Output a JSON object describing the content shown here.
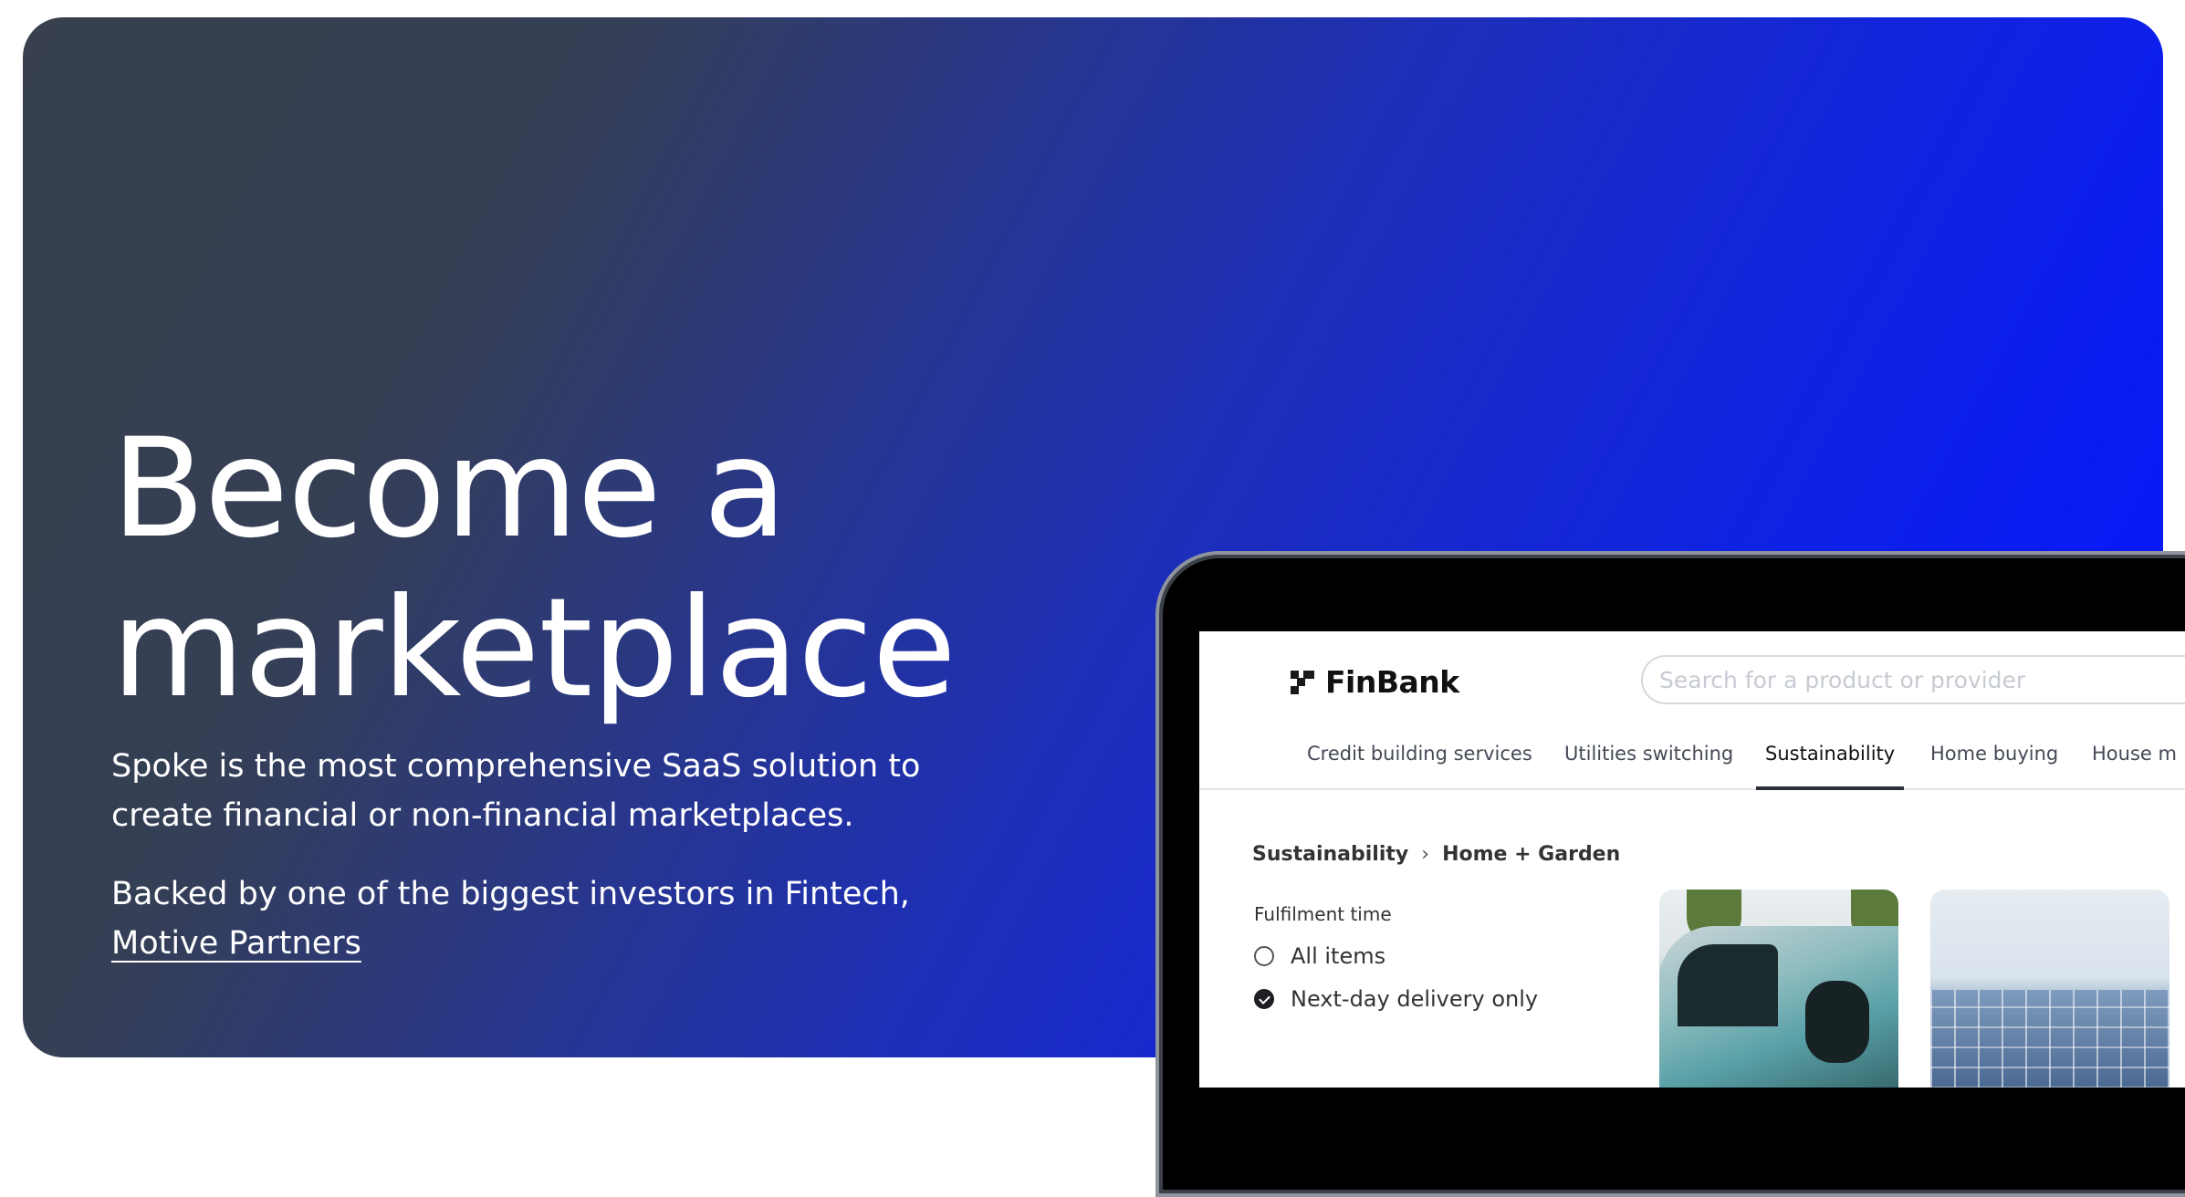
{
  "hero": {
    "headline_line1": "Become a",
    "headline_line2": "marketplace",
    "description": "Spoke is the most comprehensive SaaS solution to create financial or non-financial marketplaces.",
    "backed_prefix": "Backed by one of the biggest investors in Fintech, ",
    "backed_link": "Motive Partners"
  },
  "mockup": {
    "brand": "FinBank",
    "search_placeholder": "Search for a product or provider",
    "tabs": [
      {
        "label": "Credit building services"
      },
      {
        "label": "Utilities switching"
      },
      {
        "label": "Sustainability",
        "active": true
      },
      {
        "label": "Home buying"
      },
      {
        "label": "House m"
      }
    ],
    "breadcrumb": [
      "Sustainability",
      "Home + Garden"
    ],
    "filter": {
      "title": "Fulfilment time",
      "options": [
        {
          "label": "All items",
          "checked": false
        },
        {
          "label": "Next-day delivery only",
          "checked": true
        }
      ]
    }
  },
  "colors": {
    "gradient_start": "#37404c",
    "gradient_end": "#0718fb",
    "text_on_hero": "#ffffff"
  }
}
